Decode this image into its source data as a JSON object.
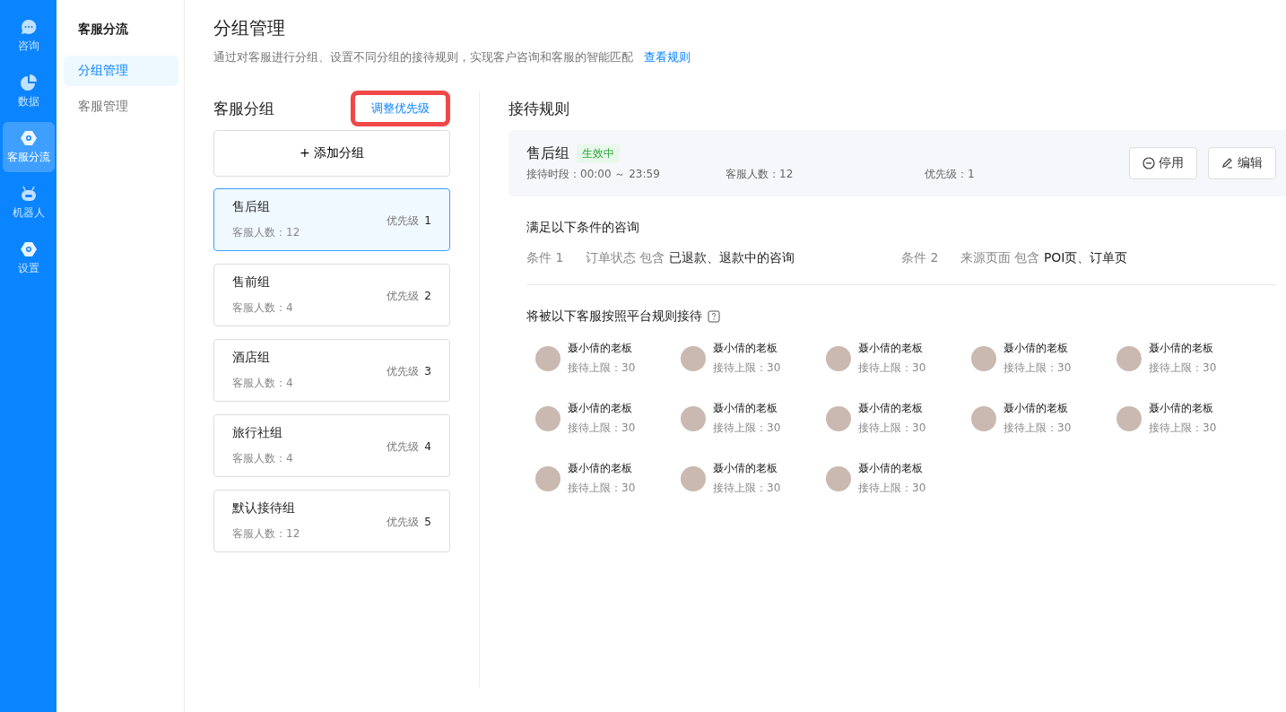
{
  "rail": [
    {
      "label": "咨询",
      "kind": "chat",
      "selected": false
    },
    {
      "label": "数据",
      "kind": "pie",
      "selected": false
    },
    {
      "label": "客服分流",
      "kind": "hex",
      "selected": true
    },
    {
      "label": "机器人",
      "kind": "robot",
      "selected": false
    },
    {
      "label": "设置",
      "kind": "hex",
      "selected": false
    }
  ],
  "submenu": {
    "title": "客服分流",
    "items": [
      {
        "label": "分组管理",
        "selected": true
      },
      {
        "label": "客服管理",
        "selected": false
      }
    ]
  },
  "page": {
    "title": "分组管理",
    "description": "通过对客服进行分组、设置不同分组的接待规则，实现客户咨询和客服的智能匹配",
    "link": "查看规则"
  },
  "groups_panel": {
    "title": "客服分组",
    "priority_button": "调整优先级",
    "priority_button_highlighted": true,
    "add_button": "+ 添加分组",
    "groups": [
      {
        "name": "售后组",
        "count": "客服人数：12",
        "priority_label": "优先级",
        "priority": "1",
        "selected": true
      },
      {
        "name": "售前组",
        "count": "客服人数：4",
        "priority_label": "优先级",
        "priority": "2",
        "selected": false
      },
      {
        "name": "酒店组",
        "count": "客服人数：4",
        "priority_label": "优先级",
        "priority": "3",
        "selected": false
      },
      {
        "name": "旅行社组",
        "count": "客服人数：4",
        "priority_label": "优先级",
        "priority": "4",
        "selected": false
      },
      {
        "name": "默认接待组",
        "count": "客服人数：12",
        "priority_label": "优先级",
        "priority": "5",
        "selected": false
      }
    ]
  },
  "rules": {
    "title": "接待规则",
    "group_name": "售后组",
    "status": "生效中",
    "hours": "接待时段：00:00 ～ 23:59",
    "staff_count": "客服人数：12",
    "priority": "优先级：1",
    "buttons": [
      {
        "label": "停用",
        "kind": "disable"
      },
      {
        "label": "编辑",
        "kind": "edit"
      }
    ],
    "conditions_title": "满足以下条件的咨询",
    "conditions": [
      {
        "label": "条件 1",
        "field": "订单状态",
        "operator": "包含",
        "value": "已退款、退款中的咨询"
      },
      {
        "label": "条件 2",
        "field": "来源页面",
        "operator": "包含",
        "value": "POI页、订单页"
      }
    ],
    "agents_title": "将被以下客服按照平台规则接待",
    "agents": [
      {
        "name": "聂小倩的老板",
        "limit": "接待上限：30"
      },
      {
        "name": "聂小倩的老板",
        "limit": "接待上限：30"
      },
      {
        "name": "聂小倩的老板",
        "limit": "接待上限：30"
      },
      {
        "name": "聂小倩的老板",
        "limit": "接待上限：30"
      },
      {
        "name": "聂小倩的老板",
        "limit": "接待上限：30"
      },
      {
        "name": "聂小倩的老板",
        "limit": "接待上限：30"
      },
      {
        "name": "聂小倩的老板",
        "limit": "接待上限：30"
      },
      {
        "name": "聂小倩的老板",
        "limit": "接待上限：30"
      },
      {
        "name": "聂小倩的老板",
        "limit": "接待上限：30"
      },
      {
        "name": "聂小倩的老板",
        "limit": "接待上限：30"
      },
      {
        "name": "聂小倩的老板",
        "limit": "接待上限：30"
      },
      {
        "name": "聂小倩的老板",
        "limit": "接待上限：30"
      },
      {
        "name": "聂小倩的老板",
        "limit": "接待上限：30"
      }
    ]
  }
}
